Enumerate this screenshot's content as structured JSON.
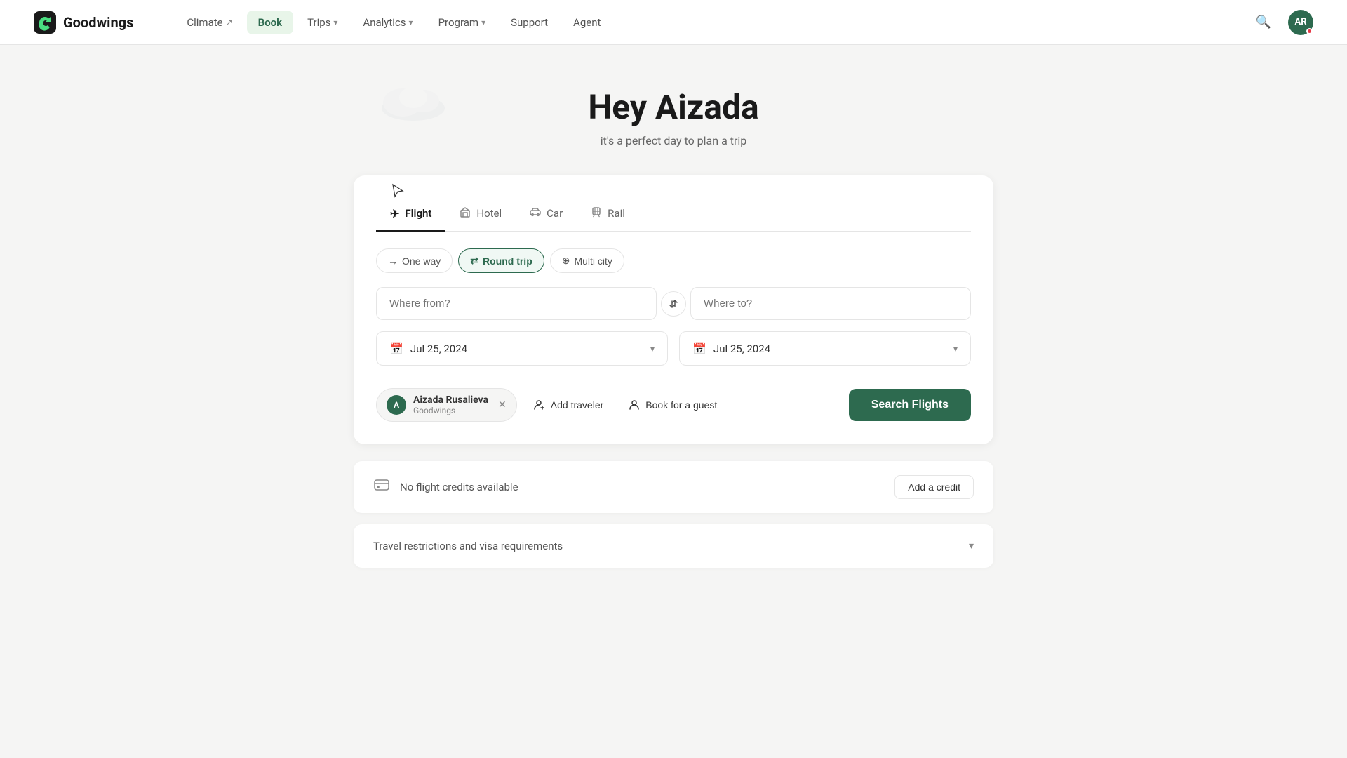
{
  "brand": {
    "name": "Goodwings",
    "logo_letter": "G"
  },
  "nav": {
    "items": [
      {
        "id": "climate",
        "label": "Climate",
        "has_ext": true,
        "active": false
      },
      {
        "id": "book",
        "label": "Book",
        "active": true
      },
      {
        "id": "trips",
        "label": "Trips",
        "has_chevron": true,
        "active": false
      },
      {
        "id": "analytics",
        "label": "Analytics",
        "has_chevron": true,
        "active": false
      },
      {
        "id": "program",
        "label": "Program",
        "has_chevron": true,
        "active": false
      },
      {
        "id": "support",
        "label": "Support",
        "active": false
      },
      {
        "id": "agent",
        "label": "Agent",
        "active": false
      }
    ],
    "avatar_initials": "AR"
  },
  "hero": {
    "greeting": "Hey Aizada",
    "subtitle": "it's a perfect day to plan a trip"
  },
  "booking": {
    "tabs": [
      {
        "id": "flight",
        "label": "Flight",
        "icon": "✈",
        "active": true
      },
      {
        "id": "hotel",
        "label": "Hotel",
        "icon": "🏨",
        "active": false
      },
      {
        "id": "car",
        "label": "Car",
        "icon": "🚗",
        "active": false
      },
      {
        "id": "rail",
        "label": "Rail",
        "icon": "🚂",
        "active": false
      }
    ],
    "trip_types": [
      {
        "id": "one-way",
        "label": "One way",
        "icon": "→",
        "active": false
      },
      {
        "id": "round-trip",
        "label": "Round trip",
        "icon": "⇄",
        "active": true
      },
      {
        "id": "multi-city",
        "label": "Multi city",
        "icon": "⊕",
        "active": false
      }
    ],
    "where_from_placeholder": "Where from?",
    "where_to_placeholder": "Where to?",
    "date_from": "Jul 25, 2024",
    "date_to": "Jul 25, 2024",
    "traveler": {
      "name": "Aizada Rusalieva",
      "company": "Goodwings",
      "avatar_initial": "A"
    },
    "add_traveler_label": "Add traveler",
    "book_for_guest_label": "Book for a guest",
    "search_flights_label": "Search Flights"
  },
  "credits": {
    "icon": "💳",
    "message": "No flight credits available",
    "add_button_label": "Add a credit"
  },
  "restrictions": {
    "label": "Travel restrictions and visa requirements"
  }
}
